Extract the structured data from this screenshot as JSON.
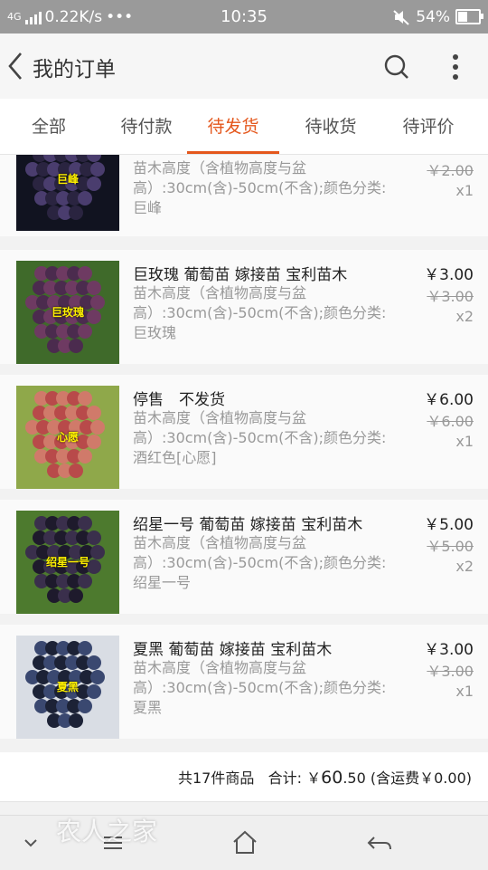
{
  "status_bar": {
    "signal_text": "4G",
    "net_speed": "0.22K/s",
    "dots": "•••",
    "time": "10:35",
    "battery": "54%"
  },
  "header": {
    "title": "我的订单",
    "back_icon": "back-arrow-icon",
    "search_icon": "search-icon",
    "more_icon": "more-vertical-icon"
  },
  "tabs": [
    {
      "label": "全部"
    },
    {
      "label": "待付款"
    },
    {
      "label": "待发货",
      "active": true
    },
    {
      "label": "待收货"
    },
    {
      "label": "待评价"
    }
  ],
  "items": [
    {
      "name": "",
      "thumb_label": "巨峰",
      "spec": "苗木高度（含植物高度与盆高）:30cm(含)-50cm(不含);颜色分类:巨峰",
      "price": "",
      "original_price": "￥2.00",
      "quantity": "x1",
      "colors": [
        "#2a2440",
        "#4a3d6e",
        "#111320"
      ]
    },
    {
      "name": "巨玫瑰 葡萄苗 嫁接苗 宝利苗木",
      "thumb_label": "巨玫瑰",
      "spec": "苗木高度（含植物高度与盆高）:30cm(含)-50cm(不含);颜色分类:巨玫瑰",
      "price": "￥3.00",
      "original_price": "￥3.00",
      "quantity": "x2",
      "colors": [
        "#4b2b4e",
        "#6e3a62",
        "#3f6a2a"
      ]
    },
    {
      "name": "停售　不发货",
      "thumb_label": "心愿",
      "spec": "苗木高度（含植物高度与盆高）:30cm(含)-50cm(不含);颜色分类:酒红色[心愿]",
      "price": "￥6.00",
      "original_price": "￥6.00",
      "quantity": "x1",
      "colors": [
        "#b84a4a",
        "#d07a6a",
        "#8fa84a"
      ]
    },
    {
      "name": "绍星一号 葡萄苗 嫁接苗 宝利苗木",
      "thumb_label": "绍星一号",
      "spec": "苗木高度（含植物高度与盆高）:30cm(含)-50cm(不含);颜色分类:绍星一号",
      "price": "￥5.00",
      "original_price": "￥5.00",
      "quantity": "x2",
      "colors": [
        "#1e1a2c",
        "#3a2f4c",
        "#4d7a2e"
      ]
    },
    {
      "name": "夏黑 葡萄苗 嫁接苗 宝利苗木",
      "thumb_label": "夏黑",
      "spec": "苗木高度（含植物高度与盆高）:30cm(含)-50cm(不含);颜色分类:夏黑",
      "price": "￥3.00",
      "original_price": "￥3.00",
      "quantity": "x1",
      "colors": [
        "#1c2236",
        "#3a4870",
        "#d9dde4"
      ]
    }
  ],
  "summary": {
    "count_text": "共17件商品",
    "total_label": "合计:",
    "total_currency": "￥",
    "total_int": "60",
    "total_dec": ".50",
    "shipping_text": "(含运费￥0.00)"
  },
  "nav": {
    "down_icon": "chevron-down-icon",
    "menu_icon": "menu-icon",
    "home_icon": "home-icon",
    "return_icon": "return-icon"
  },
  "watermark": "农人之家",
  "colors": {
    "accent": "#e4571c",
    "status_bar": "#9a9a9a",
    "muted_text": "#999999"
  }
}
